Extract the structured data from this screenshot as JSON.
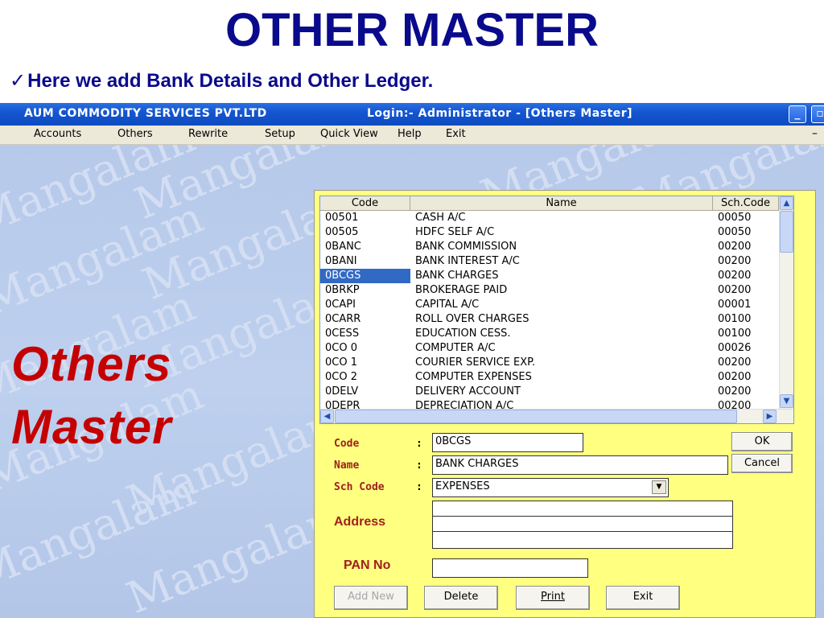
{
  "slide": {
    "title": "OTHER MASTER",
    "checkmark": "✓",
    "subtitle": "Here we add Bank Details and Other Ledger."
  },
  "window": {
    "app_title": "AUM COMMODITY SERVICES PVT.LTD",
    "login_title": "Login:-   Administrator - [Others Master]"
  },
  "menu": {
    "items": [
      "Accounts",
      "Others",
      "Rewrite",
      "Setup",
      "Quick View",
      "Help",
      "Exit"
    ],
    "dash": "–"
  },
  "background": {
    "watermark": "Mangalam",
    "big_label_line1": "Others",
    "big_label_line2": "Master"
  },
  "grid": {
    "headers": {
      "code": "Code",
      "name": "Name",
      "sch_code": "Sch.Code"
    },
    "rows": [
      {
        "code": "00501",
        "name": "CASH A/C",
        "sch": "00050"
      },
      {
        "code": "00505",
        "name": "HDFC SELF A/C",
        "sch": "00050"
      },
      {
        "code": "0BANC",
        "name": "BANK COMMISSION",
        "sch": "00200"
      },
      {
        "code": "0BANI",
        "name": "BANK INTEREST A/C",
        "sch": "00200"
      },
      {
        "code": "0BCGS",
        "name": "BANK CHARGES",
        "sch": "00200"
      },
      {
        "code": "0BRKP",
        "name": "BROKERAGE PAID",
        "sch": "00200"
      },
      {
        "code": "0CAPI",
        "name": "CAPITAL A/C",
        "sch": "00001"
      },
      {
        "code": "0CARR",
        "name": "ROLL OVER CHARGES",
        "sch": "00100"
      },
      {
        "code": "0CESS",
        "name": "EDUCATION CESS.",
        "sch": "00100"
      },
      {
        "code": "0CO 0",
        "name": "COMPUTER A/C",
        "sch": "00026"
      },
      {
        "code": "0CO 1",
        "name": "COURIER SERVICE EXP.",
        "sch": "00200"
      },
      {
        "code": "0CO 2",
        "name": "COMPUTER EXPENSES",
        "sch": "00200"
      },
      {
        "code": "0DELV",
        "name": "DELIVERY ACCOUNT",
        "sch": "00200"
      },
      {
        "code": "0DEPR",
        "name": "DEPRECIATION A/C",
        "sch": "00200"
      }
    ],
    "selected_row": 4
  },
  "form": {
    "code_label": "Code",
    "name_label": "Name",
    "sch_label": "Sch Code",
    "colon": ":",
    "code_value": "0BCGS",
    "name_value": "BANK CHARGES",
    "sch_value": "EXPENSES",
    "address_label": "Address",
    "address_lines": [
      "",
      "",
      ""
    ],
    "pan_label": "PAN No",
    "pan_value": ""
  },
  "buttons": {
    "ok": "OK",
    "cancel": "Cancel",
    "add_new": "Add New",
    "delete": "Delete",
    "print": "Print",
    "exit": "Exit"
  },
  "colors": {
    "title_blue": "#0a0a8c",
    "titlebar_blue": "#1456d2",
    "label_red": "#c50000",
    "panel_yellow": "#ffff80",
    "selection_blue": "#316ac5"
  }
}
